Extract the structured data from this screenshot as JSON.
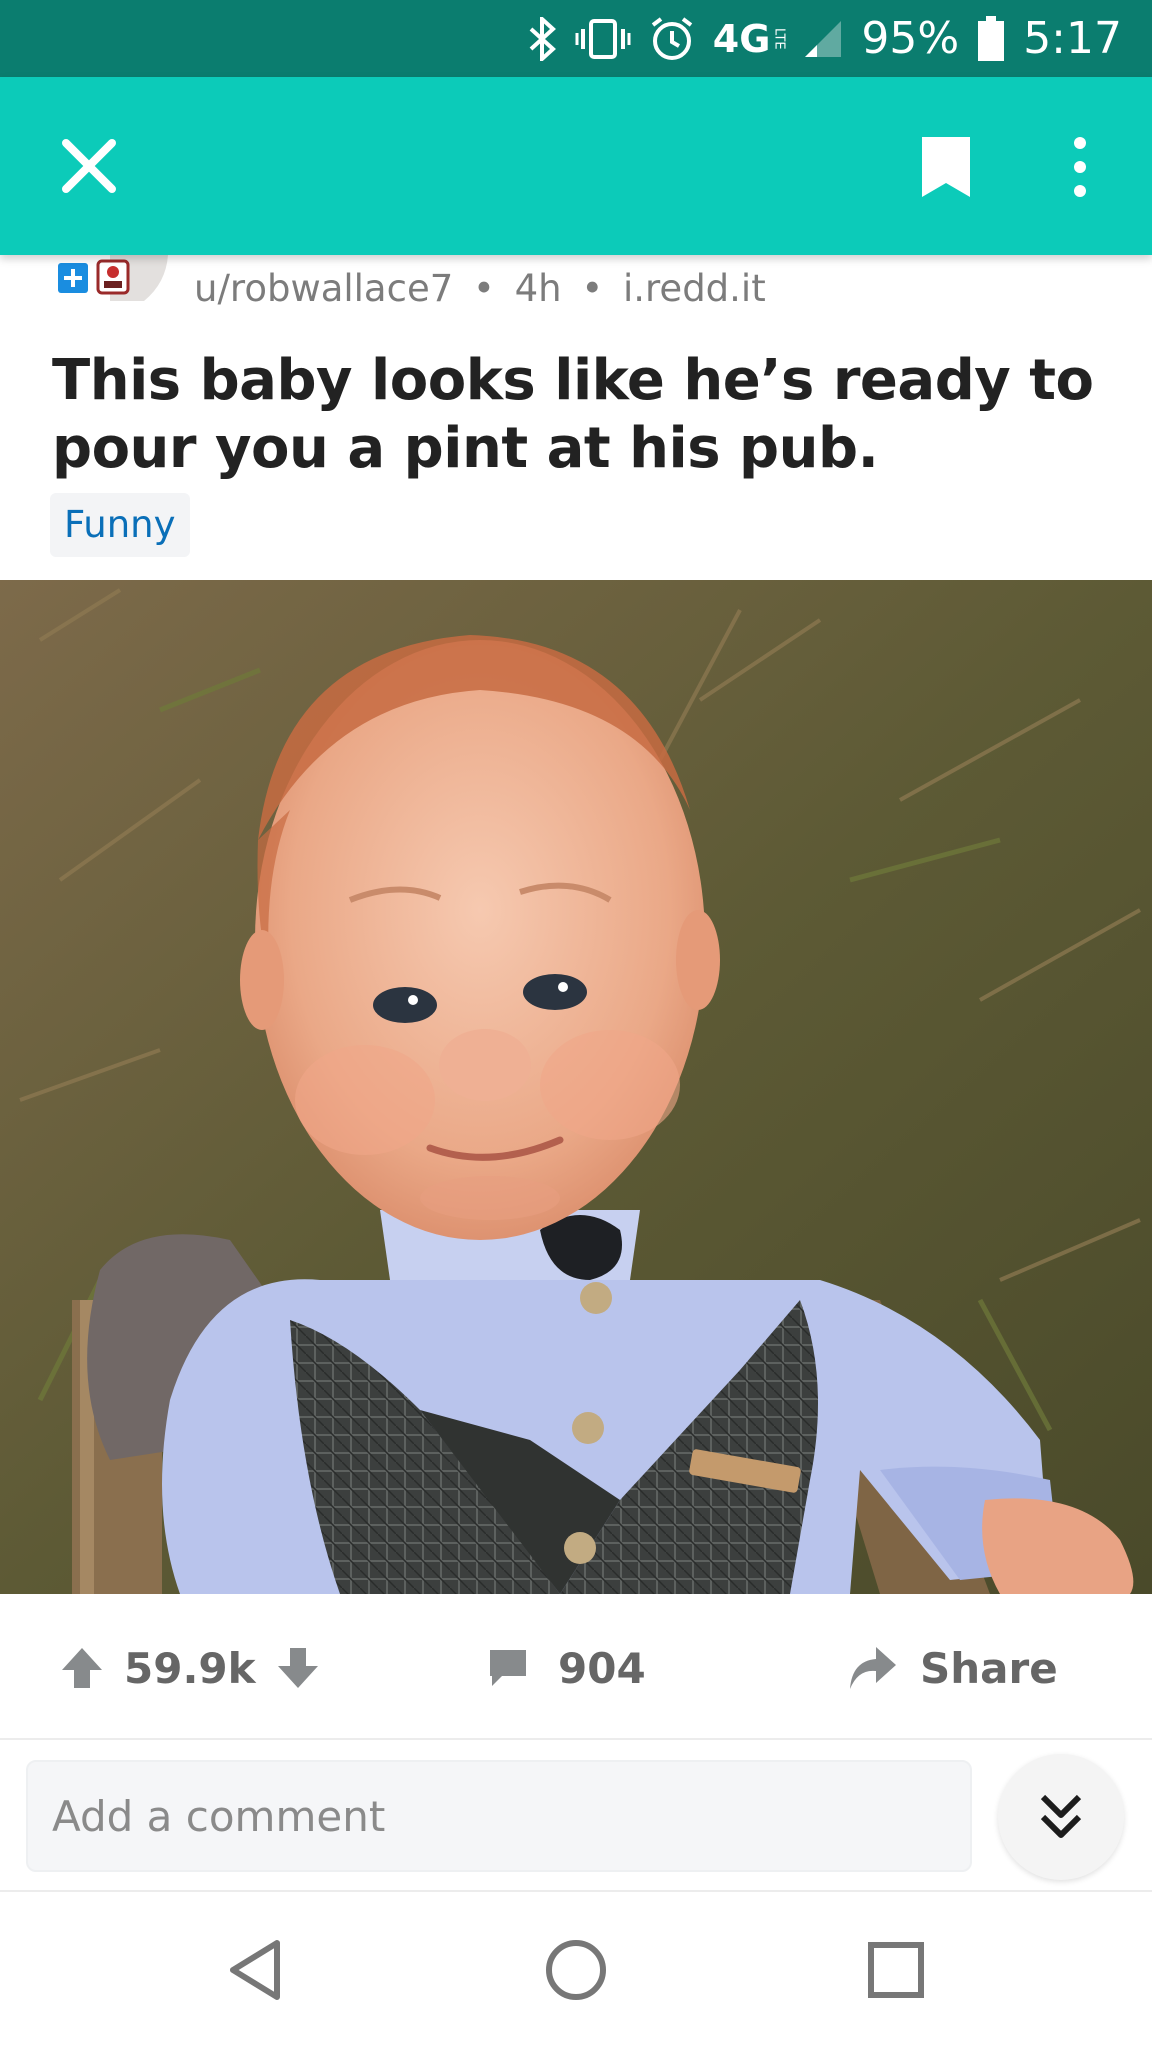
{
  "status_bar": {
    "network": "4G",
    "network_sub": "LTE",
    "battery": "95%",
    "battery_level": 0.95,
    "time": "5:17",
    "icons": [
      "bluetooth-icon",
      "vibrate-icon",
      "alarm-icon",
      "signal-icon",
      "battery-icon"
    ]
  },
  "app_bar": {
    "background_color": "#0ccbb9",
    "icons": [
      "close-icon",
      "bookmark-icon",
      "more-vertical-icon"
    ]
  },
  "post": {
    "author": "u/robwallace7",
    "age": "4h",
    "domain": "i.redd.it",
    "separator": "•",
    "title": "This baby looks like he’s ready to pour you a pint at his pub.",
    "flair": "Funny",
    "flair_color": "#0a6fb8"
  },
  "actions": {
    "vote_count": "59.9k",
    "comment_count": "904",
    "share_label": "Share"
  },
  "comment_bar": {
    "placeholder": "Add a comment"
  },
  "nav_bar": {
    "icons": [
      "back-icon",
      "home-icon",
      "recents-icon"
    ]
  }
}
